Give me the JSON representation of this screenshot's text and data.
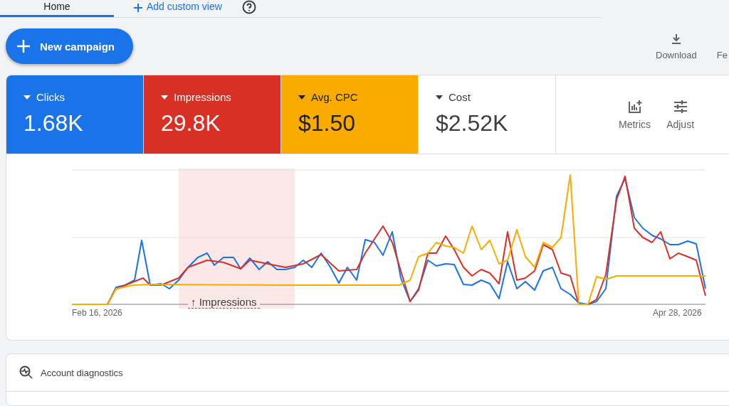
{
  "tabs": [
    {
      "label": "Home",
      "selected": true
    },
    {
      "label": "Add custom view",
      "selected": false
    }
  ],
  "new_campaign_button": {
    "label": "New campaign"
  },
  "toolbar": [
    {
      "label": "Download"
    },
    {
      "label": "Fe"
    }
  ],
  "metrics": [
    {
      "label": "Clicks",
      "value": "1.68K",
      "selected": true,
      "color": "#1a73e8"
    },
    {
      "label": "Impressions",
      "value": "29.8K",
      "selected": true,
      "color": "#d93025"
    },
    {
      "label": "Avg. CPC",
      "value": "$1.50",
      "selected": true,
      "color": "#f9ab00"
    },
    {
      "label": "Cost",
      "value": "$2.52K",
      "selected": false
    }
  ],
  "metric_actions": [
    {
      "label": "Metrics"
    },
    {
      "label": "Adjust"
    }
  ],
  "chart": {
    "x_start": "Feb 16, 2026",
    "x_end": "Apr 28, 2026",
    "highlight_label": "↑ Impressions"
  },
  "diagnostics": {
    "title": "Account diagnostics"
  }
}
